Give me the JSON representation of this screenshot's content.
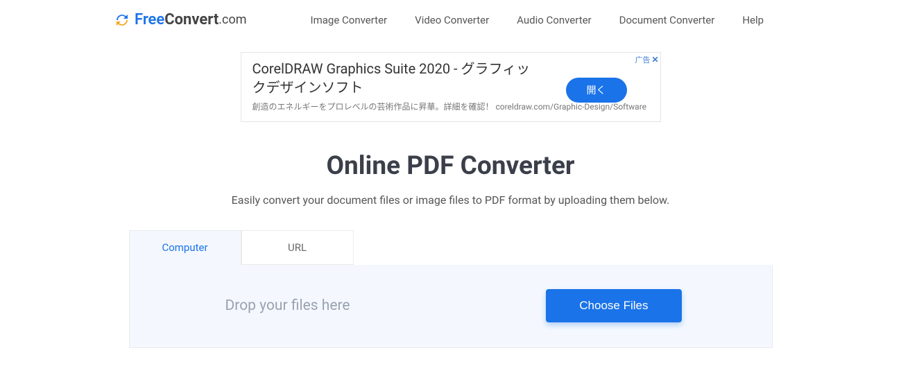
{
  "logo": {
    "free": "Free",
    "convert": "Convert",
    "com": ".com"
  },
  "nav": {
    "items": [
      "Image Converter",
      "Video Converter",
      "Audio Converter",
      "Document Converter",
      "Help"
    ]
  },
  "ad": {
    "badge_text": "广告",
    "title": "CorelDRAW Graphics Suite 2020 - グラフィックデザインソフト",
    "subtitle": "創造のエネルギーをプロレベルの芸術作品に昇華。詳細を確認！ coreldraw.com/Graphic-Design/Software",
    "button": "開く"
  },
  "page": {
    "title": "Online PDF Converter",
    "subtitle": "Easily convert your document files or image files to PDF format by uploading them below."
  },
  "tabs": {
    "computer": "Computer",
    "url": "URL"
  },
  "dropzone": {
    "text": "Drop your files here",
    "button": "Choose Files"
  }
}
